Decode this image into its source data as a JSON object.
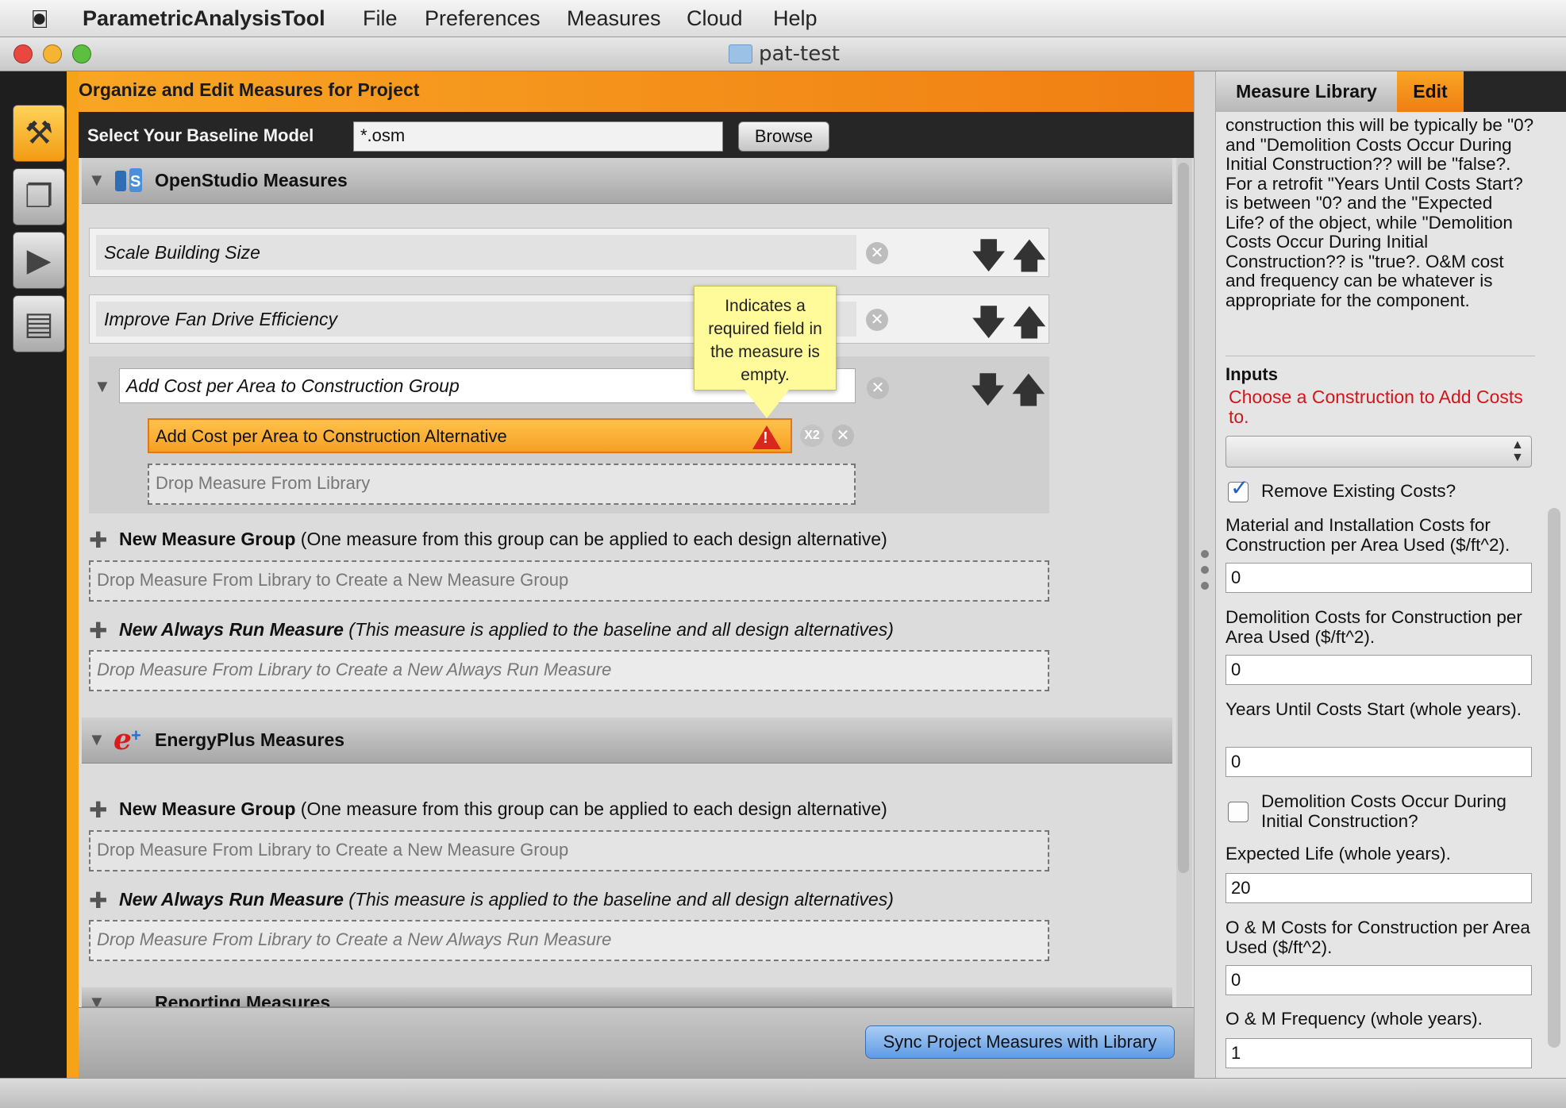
{
  "menubar": {
    "app_name": "ParametricAnalysisTool",
    "items": [
      "File",
      "Preferences",
      "Measures",
      "Cloud",
      "Help"
    ]
  },
  "window": {
    "title": "pat-test"
  },
  "colors": {
    "accent": "#f29b12",
    "required": "#d0161b",
    "sync_button": "#5f9be4"
  },
  "main": {
    "header": "Organize and Edit Measures for Project",
    "baseline_label": "Select Your Baseline Model",
    "baseline_value": "*.osm",
    "browse_label": "Browse",
    "openstudio": {
      "title": "OpenStudio Measures",
      "measures": [
        "Scale Building Size",
        "Improve Fan Drive Efficiency"
      ],
      "group_name": "Add Cost per Area to Construction Group",
      "alternative": "Add Cost per Area to Construction Alternative",
      "alternative_badge": "X2",
      "drop_library": "Drop Measure From Library",
      "new_group_bold": "New Measure Group",
      "new_group_desc": " (One measure from this group can be applied to each design alternative)",
      "new_group_drop": "Drop Measure From Library to Create a New Measure Group",
      "always_run_bold": "New Always Run Measure",
      "always_run_desc": " (This measure is applied to the baseline and all design alternatives)",
      "always_run_drop": "Drop Measure From Library to Create a New Always Run Measure"
    },
    "energyplus": {
      "title": "EnergyPlus Measures",
      "new_group_bold": "New Measure Group",
      "new_group_desc": " (One measure from this group can be applied to each design alternative)",
      "new_group_drop": "Drop Measure From Library to Create a New Measure Group",
      "always_run_bold": "New Always Run Measure",
      "always_run_desc": " (This measure is applied to the baseline and all design alternatives)",
      "always_run_drop": "Drop Measure From Library to Create a New Always Run Measure"
    },
    "reporting_title": "Reporting Measures",
    "tooltip": "Indicates a required field in the measure is empty.",
    "sync_label": "Sync Project Measures with Library"
  },
  "right": {
    "tabs": [
      "Measure Library",
      "Edit"
    ],
    "description": "construction this will be typically be \"0? and \"Demolition Costs Occur During Initial Construction?? will be \"false?. For a retrofit \"Years Until Costs Start? is between \"0? and the \"Expected Life? of the object, while \"Demolition Costs Occur During Initial Construction?? is \"true?. O&M cost and frequency can be whatever is appropriate for the component.",
    "inputs_title": "Inputs",
    "choose_label": "Choose a Construction to Add Costs to.",
    "remove_existing_label": "Remove Existing Costs?",
    "remove_existing_checked": true,
    "material_label": "Material and Installation Costs for Construction per Area Used ($/ft^2).",
    "material_value": "0",
    "demolition_label": "Demolition Costs for Construction per Area Used ($/ft^2).",
    "demolition_value": "0",
    "years_label": "Years Until Costs Start (whole years).",
    "years_value": "0",
    "demo_initial_label": "Demolition Costs Occur During Initial Construction?",
    "demo_initial_checked": false,
    "life_label": "Expected Life (whole years).",
    "life_value": "20",
    "om_cost_label": "O & M Costs for Construction per Area Used ($/ft^2).",
    "om_cost_value": "0",
    "om_freq_label": "O & M Frequency (whole years).",
    "om_freq_value": "1"
  }
}
